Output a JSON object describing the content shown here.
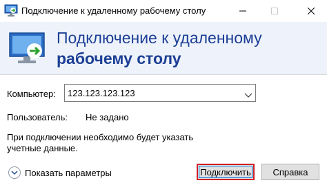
{
  "window": {
    "title": "Подключение к удаленному рабочему столу"
  },
  "header": {
    "title_line1": "Подключение к удаленному",
    "title_line2": "рабочему столу"
  },
  "form": {
    "computer_label": "Компьютер:",
    "computer_value": "123.123.123.123",
    "user_label": "Пользователь:",
    "user_value": "Не задано",
    "note": "При подключении необходимо будет указать учетные данные."
  },
  "footer": {
    "show_options_label": "Показать параметры",
    "connect_label": "Подключить",
    "help_label": "Справка"
  },
  "icons": {
    "title": "remote-desktop-icon",
    "header": "remote-desktop-icon",
    "combo": "chevron-down-icon",
    "options": "chevron-down-circle-icon"
  },
  "colors": {
    "header_background": "#eef3fb",
    "header_text": "#1c3f95",
    "connect_highlight": "#d32026"
  }
}
